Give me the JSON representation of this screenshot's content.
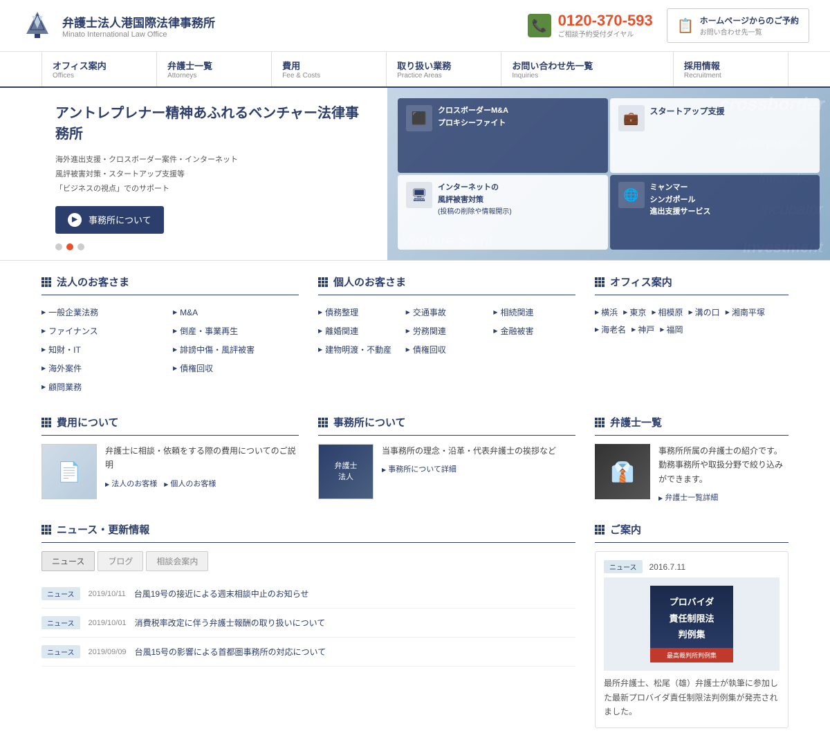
{
  "header": {
    "firm_name_jp": "弁護士法人港国際法律事務所",
    "firm_name_en": "Minato International Law Office",
    "phone": "0120-370-593",
    "phone_label": "ご相談予約受付ダイヤル",
    "contact_label": "ホームページからのご予約",
    "contact_sublabel": "お問い合わせ先一覧"
  },
  "nav": {
    "items": [
      {
        "jp": "オフィス案内",
        "en": "Offices"
      },
      {
        "jp": "弁護士一覧",
        "en": "Attorneys"
      },
      {
        "jp": "費用",
        "en": "Fee & Costs"
      },
      {
        "jp": "取り扱い業務",
        "en": "Practice Areas"
      },
      {
        "jp": "お問い合わせ先一覧",
        "en": "Inquiries"
      },
      {
        "jp": "採用情報",
        "en": "Recruitment"
      }
    ]
  },
  "hero": {
    "title": "アントレプレナー精神あふれるベンチャー法律事務所",
    "desc": "海外進出支援・クロスボーダー案件・インターネット\n風評被害対策・スタートアップ支援等\n「ビジネスの視点」でのサポート",
    "btn_label": "事務所について",
    "watermark": "Venture Spirit",
    "watermark2": "crossborder",
    "cards": [
      {
        "title": "クロスボーダーM&A\nプロキシーファイト",
        "icon": "⬛"
      },
      {
        "title": "スタートアップ支援",
        "icon": "💼"
      },
      {
        "title": "インターネットの\n風評被害対策\n(投稿の削除や情報開示)",
        "icon": "🖥"
      },
      {
        "title": "ミャンマー\nシンガポール\n進出支援サービス",
        "icon": "🌐"
      }
    ]
  },
  "hojin": {
    "title": "法人のお客さま",
    "links": [
      "一般企業法務",
      "M&A",
      "ファイナンス",
      "倒産・事業再生",
      "知財・IT",
      "誹謗中傷・風評被害",
      "海外案件",
      "債権回収",
      "顧問業務"
    ]
  },
  "kojin": {
    "title": "個人のお客さま",
    "links": [
      "債務整理",
      "交通事故",
      "相続関連",
      "離婚関連",
      "労務関連",
      "金融被害",
      "建物明渡・不動産",
      "債権回収"
    ]
  },
  "office": {
    "title": "オフィス案内",
    "locations": [
      "横浜",
      "東京",
      "相模原",
      "溝の口",
      "湘南平塚",
      "海老名",
      "神戸",
      "福岡"
    ]
  },
  "cost": {
    "title": "費用について",
    "desc": "弁護士に相談・依頼をする際の費用についてのご説明",
    "links": [
      "法人のお客様",
      "個人のお客様"
    ]
  },
  "jimusho": {
    "title": "事務所について",
    "desc": "当事務所の理念・沿革・代表弁護士の挨拶など",
    "link": "事務所について詳細"
  },
  "attorney": {
    "title": "弁護士一覧",
    "desc": "事務所所属の弁護士の紹介です。勤務事務所や取扱分野で絞り込みができます。",
    "link": "弁護士一覧詳細"
  },
  "news": {
    "title": "ニュース・更新情報",
    "tabs": [
      "ニュース",
      "ブログ",
      "相談会案内"
    ],
    "items": [
      {
        "badge": "ニュース",
        "date": "2019/10/11",
        "title": "台風19号の接近による週末相談中止のお知らせ"
      },
      {
        "badge": "ニュース",
        "date": "2019/10/01",
        "title": "消費税率改定に伴う弁護士報酬の取り扱いについて"
      },
      {
        "badge": "ニュース",
        "date": "2019/09/09",
        "title": "台風15号の影響による首都圏事務所の対応について"
      }
    ]
  },
  "guide": {
    "title": "ご案内",
    "news_badge": "ニュース",
    "date": "2016.7.11",
    "book_title": "プロバイダ\n責任制限法\n判例集",
    "book_subtitle": "最高裁判所判例集",
    "desc": "最所弁護士、松尾（雄）弁護士が執筆に参加した最新プロバイダ責任制限法判例集が発売されました。"
  }
}
